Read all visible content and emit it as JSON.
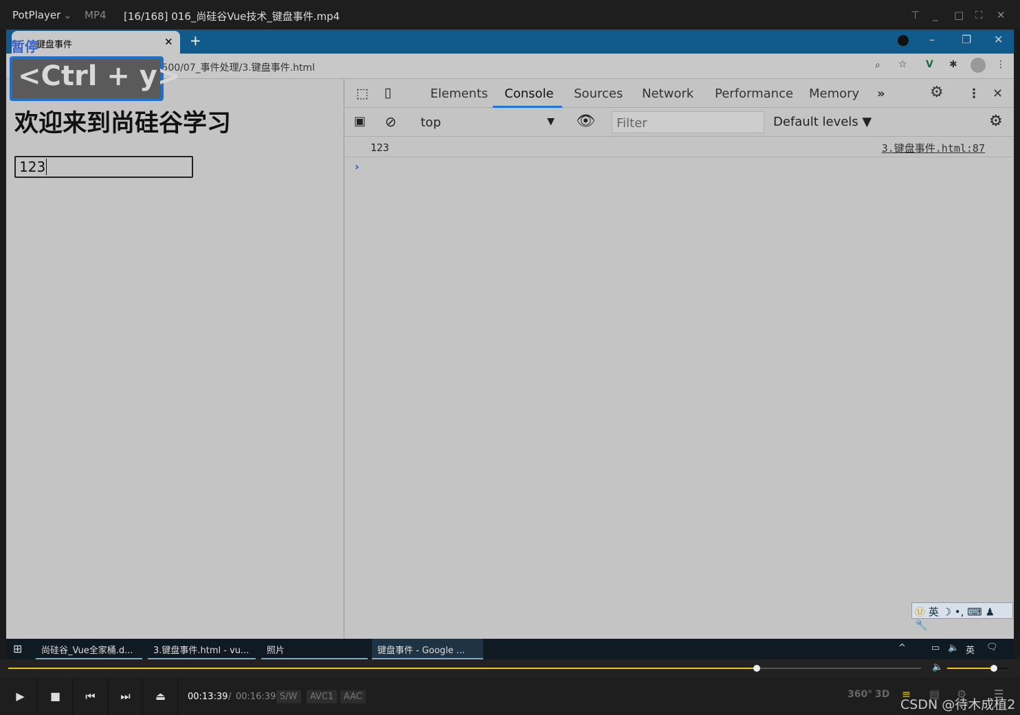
{
  "player": {
    "app_name": "PotPlayer",
    "format": "MP4",
    "title": "[16/168] 016_尚硅谷Vue技术_键盘事件.mp4",
    "osd_status": "暂停",
    "osd_shortcut": "<Ctrl + y>",
    "time_current": "00:13:39",
    "time_total": "00:16:39",
    "badges": [
      "S/W",
      "AVC1",
      "AAC"
    ],
    "progress": 0.82,
    "volume": 0.77,
    "right_icons": [
      "360°",
      "3D"
    ],
    "watermark": "CSDN @待木成植2"
  },
  "browser": {
    "tab_title": "键盘事件",
    "url": "127.0.0.1:5500/07_事件处理/3.键盘事件.html"
  },
  "page": {
    "heading": "欢迎来到尚硅谷学习",
    "input_value": "123"
  },
  "devtools": {
    "tabs": [
      "Elements",
      "Console",
      "Sources",
      "Network",
      "Performance",
      "Memory"
    ],
    "active_tab": "Console",
    "context": "top",
    "filter_placeholder": "Filter",
    "levels": "Default levels ▼",
    "log": {
      "message": "123",
      "source": "3.键盘事件.html:87"
    }
  },
  "taskbar": {
    "items": [
      "尚硅谷_Vue全家桶.d...",
      "3.键盘事件.html - vu...",
      "照片",
      "键盘事件 - Google ..."
    ],
    "ime": "英"
  },
  "colors": {
    "accent": "#f2c800",
    "tabstrip": "#115b8c"
  }
}
